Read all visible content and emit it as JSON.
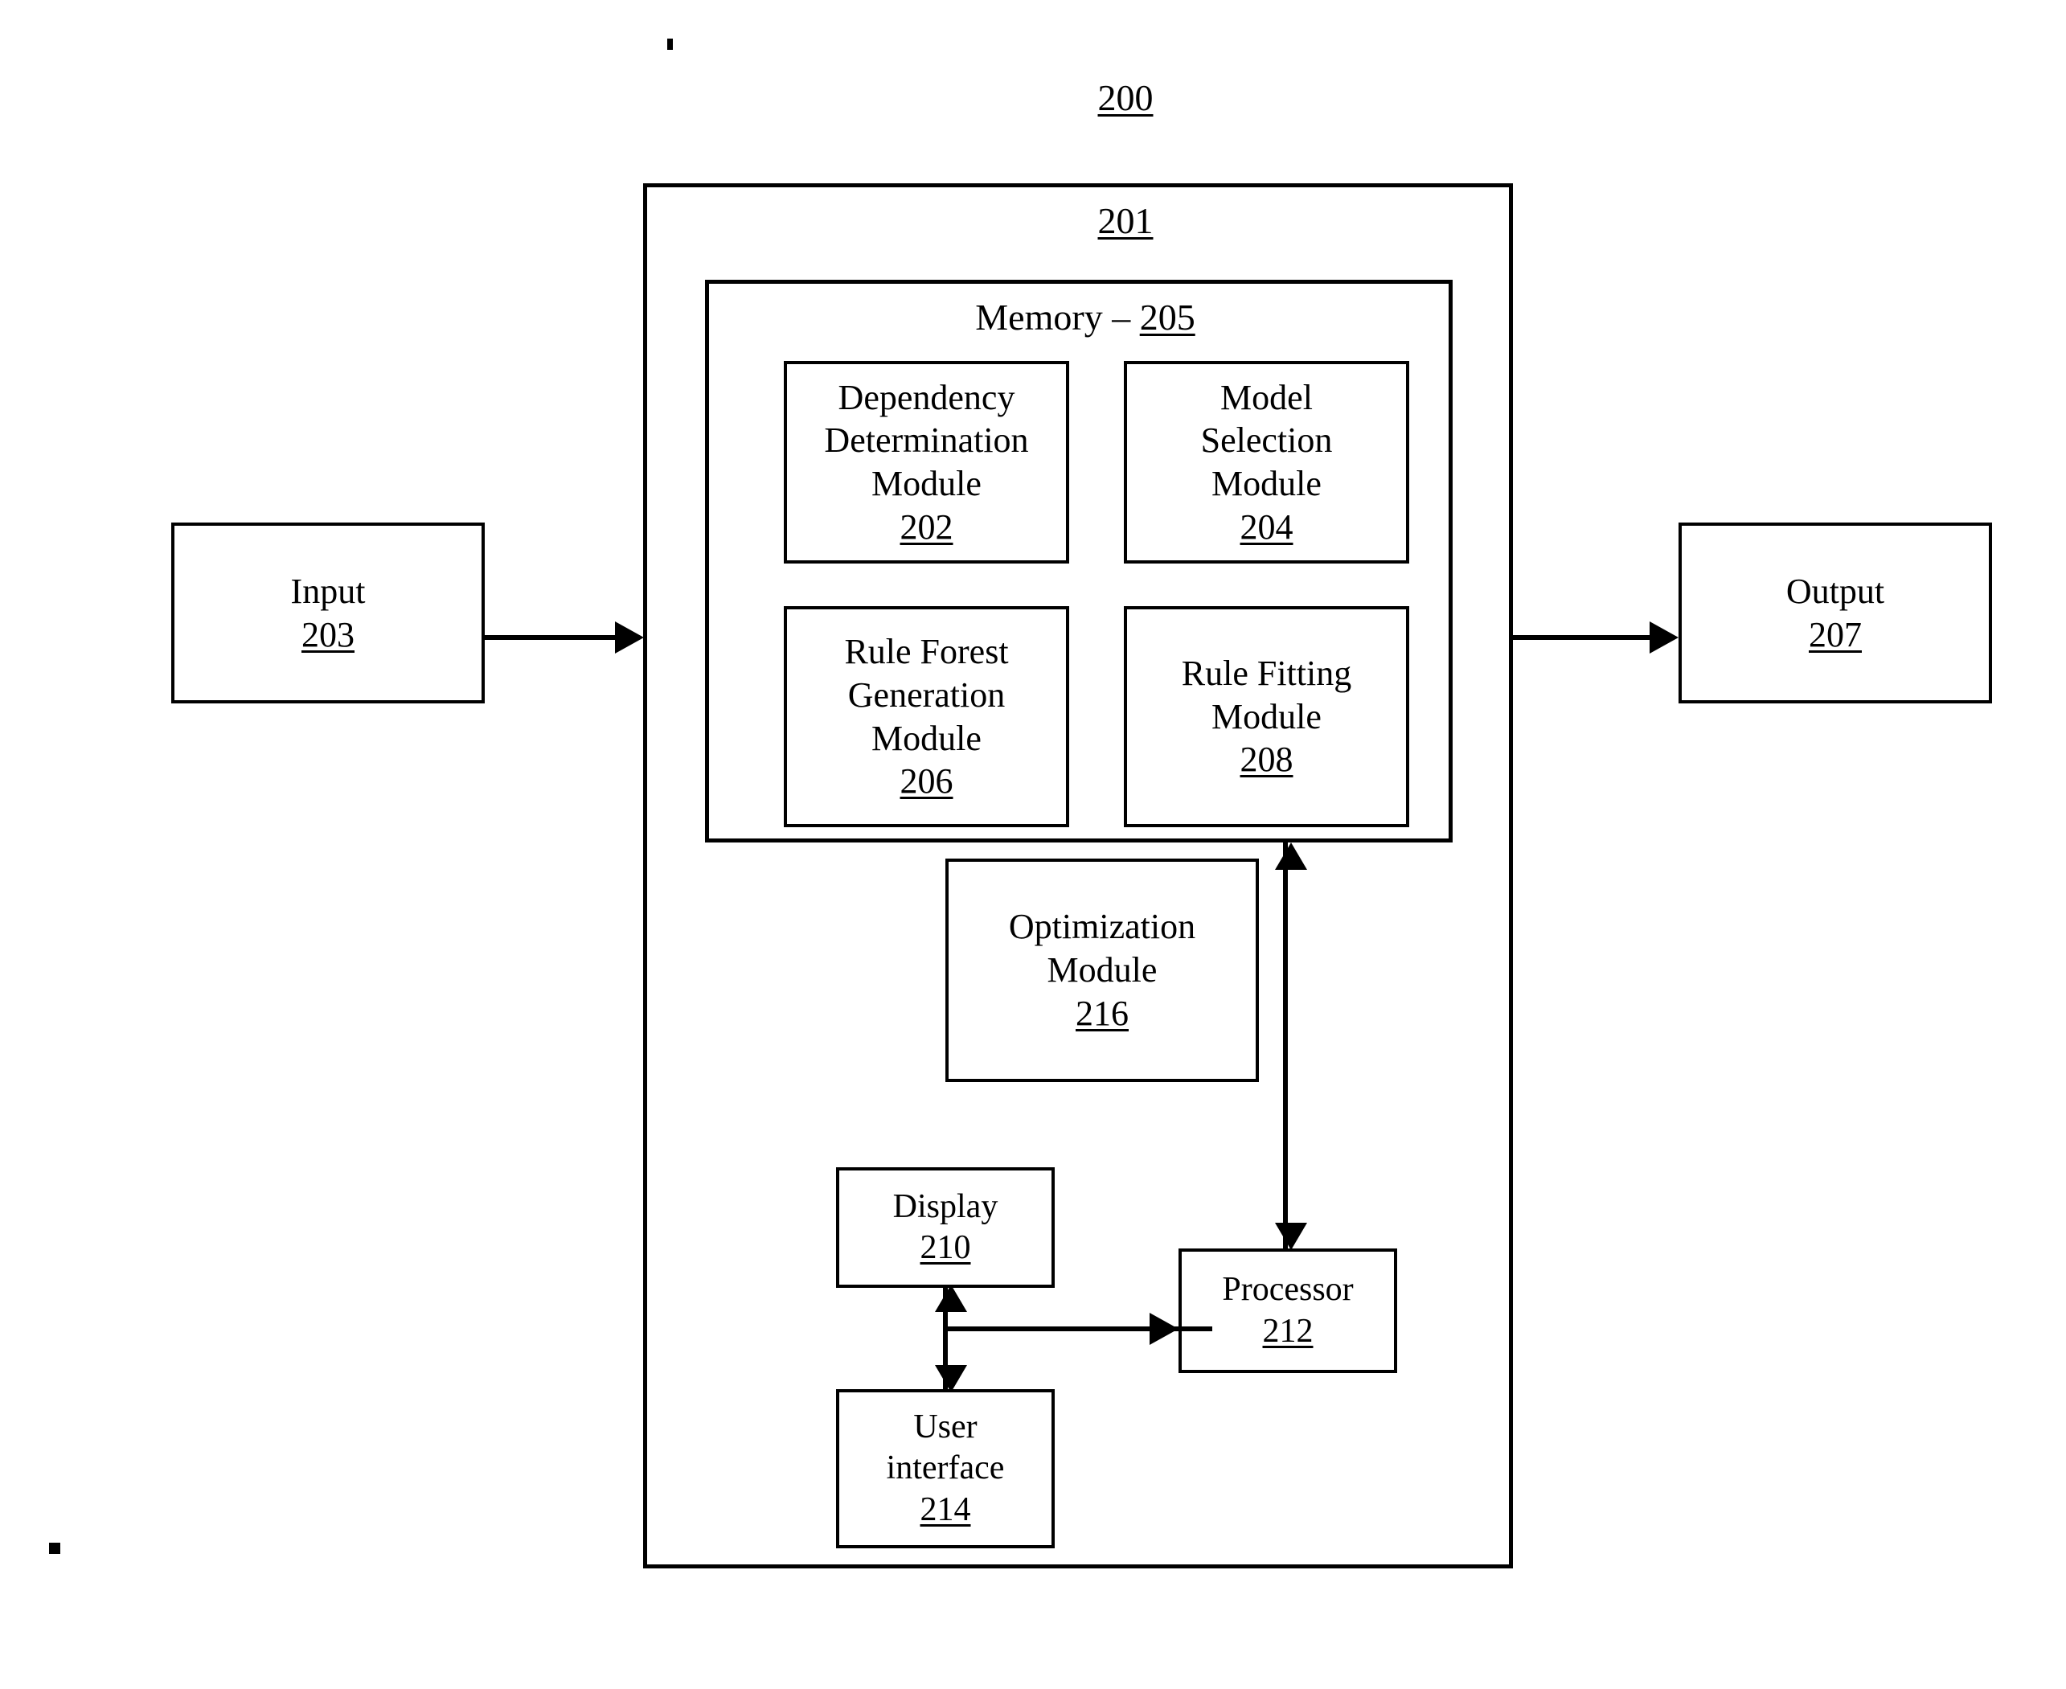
{
  "figure": {
    "number": "200",
    "system_label": "201"
  },
  "memory": {
    "title_text": "Memory – ",
    "ref": "205"
  },
  "modules": [
    {
      "name": "dependency-determination-module",
      "lines": [
        "Dependency",
        "Determination",
        "Module"
      ],
      "ref": "202"
    },
    {
      "name": "model-selection-module",
      "lines": [
        "Model",
        "Selection",
        "Module"
      ],
      "ref": "204"
    },
    {
      "name": "rule-forest-generation-module",
      "lines": [
        "Rule Forest",
        "Generation",
        "Module"
      ],
      "ref": "206"
    },
    {
      "name": "rule-fitting-module",
      "lines": [
        "Rule Fitting",
        "Module"
      ],
      "ref": "208"
    },
    {
      "name": "optimization-module",
      "lines": [
        "Optimization",
        "Module"
      ],
      "ref": "216"
    }
  ],
  "io": {
    "input": {
      "label": "Input",
      "ref": "203"
    },
    "output": {
      "label": "Output",
      "ref": "207"
    }
  },
  "hardware": {
    "display": {
      "label": "Display",
      "ref": "210"
    },
    "processor": {
      "label": "Processor",
      "ref": "212"
    },
    "user_interface": {
      "lines": [
        "User",
        "interface"
      ],
      "ref": "214"
    }
  },
  "colors": {
    "line": "#000000",
    "background": "#ffffff"
  }
}
